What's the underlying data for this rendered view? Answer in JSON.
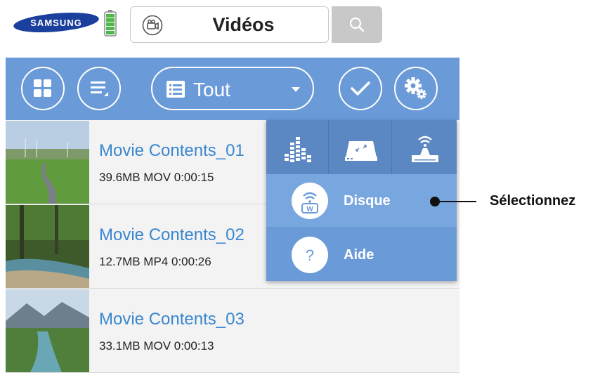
{
  "header": {
    "logo_text": "SAMSUNG",
    "title": "Vidéos",
    "logo_icon": "samsung-logo",
    "battery_icon": "battery-icon",
    "title_icon": "video-camera-icon",
    "search_icon": "search-icon"
  },
  "toolbar": {
    "grid_icon": "grid-view-icon",
    "list_icon": "list-view-icon",
    "filter_label": "Tout",
    "select_icon": "checkmark-icon",
    "settings_icon": "settings-gear-icon"
  },
  "videos": [
    {
      "title": "Movie Contents_01",
      "meta": "39.6MB  MOV  0:00:15"
    },
    {
      "title": "Movie Contents_02",
      "meta": "12.7MB  MP4  0:00:26"
    },
    {
      "title": "Movie Contents_03",
      "meta": "33.1MB  MOV  0:00:13"
    }
  ],
  "menu": {
    "tab_icons": [
      "equalizer-icon",
      "storage-drive-icon",
      "wifi-router-icon"
    ],
    "items": [
      {
        "label": "Disque",
        "icon": "wifi-disk-icon",
        "selected": true
      },
      {
        "label": "Aide",
        "icon": "help-icon",
        "selected": false
      }
    ]
  },
  "callout": {
    "text": "Sélectionnez"
  },
  "colors": {
    "toolbar": "#6a9bd8",
    "menu_tabs": "#5b88c2",
    "menu_selected": "#78a6df",
    "video_title": "#3a87cf"
  }
}
